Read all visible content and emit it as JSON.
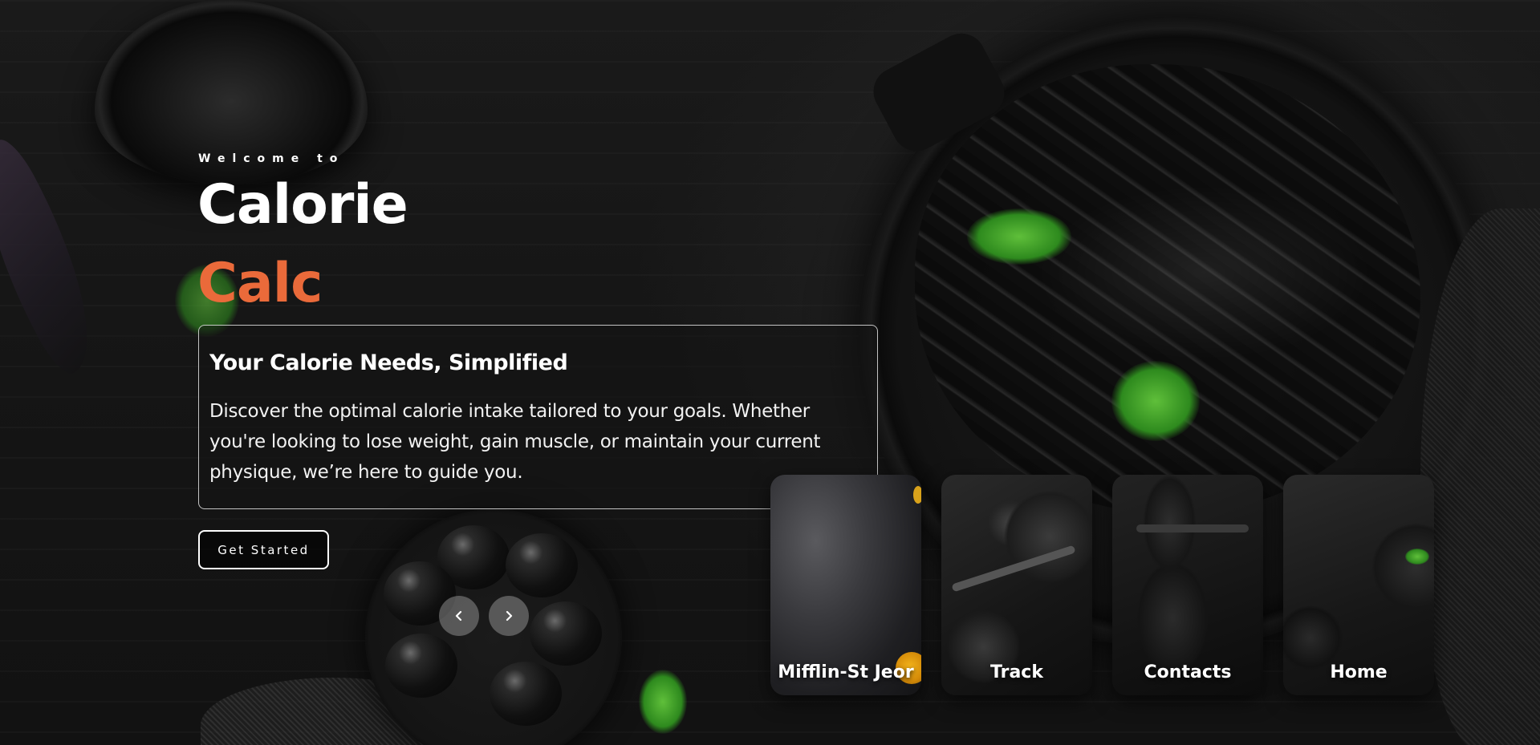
{
  "hero": {
    "welcome": "Welcome to",
    "title_line1": "Calorie",
    "title_line2": "Calc",
    "title_line2_color": "#ea6a3a"
  },
  "info_card": {
    "heading": "Your Calorie Needs, Simplified",
    "body": "Discover the optimal calorie intake tailored to your goals. Whether you're looking to lose weight, gain muscle, or maintain your current physique, we’re here to guide you."
  },
  "cta": {
    "label": "Get Started"
  },
  "slider": {
    "prev_icon": "chevron-left-icon",
    "next_icon": "chevron-right-icon"
  },
  "nav_cards": [
    {
      "label": "Mifflin-St Jeor"
    },
    {
      "label": "Track"
    },
    {
      "label": "Contacts"
    },
    {
      "label": "Home"
    }
  ],
  "colors": {
    "accent": "#ea6a3a",
    "background": "#151515",
    "text": "#ffffff"
  }
}
